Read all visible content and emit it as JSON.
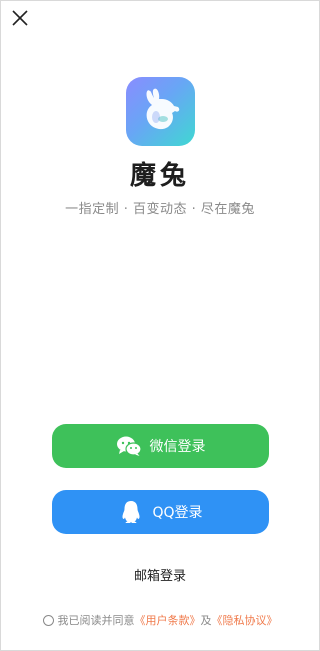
{
  "app": {
    "name": "魔兔",
    "tagline": "一指定制 · 百变动态 · 尽在魔兔"
  },
  "buttons": {
    "wechat_label": "微信登录",
    "qq_label": "QQ登录",
    "email_label": "邮箱登录"
  },
  "agreement": {
    "prefix": "我已阅读并同意",
    "terms_link": "《用户条款》",
    "conjunction": "及",
    "privacy_link": "《隐私协议》"
  },
  "icons": {
    "close": "close-icon",
    "logo": "rabbit-logo-icon",
    "wechat": "wechat-icon",
    "qq": "qq-penguin-icon",
    "radio": "radio-unchecked-icon"
  },
  "colors": {
    "wechat_button": "#3ec15a",
    "qq_button": "#2f92f5",
    "link": "#f07a4b",
    "muted_text": "#8a8a8a"
  }
}
